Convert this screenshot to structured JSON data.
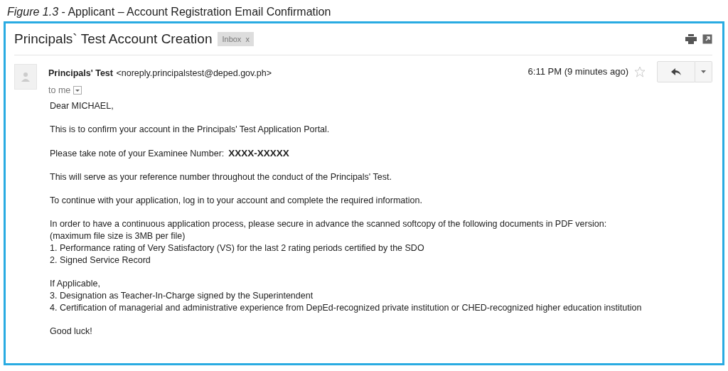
{
  "caption": "*Figure 1.3* - Applicant – Account Registration Email Confirmation",
  "subject": "Principals` Test Account Creation",
  "labels": [
    {
      "text": "Inbox",
      "close": "x"
    }
  ],
  "sender": {
    "name": "Principals' Test",
    "email": "<noreply.principalstest@deped.gov.ph>",
    "recipient": "to me",
    "time": "6:11 PM (9 minutes ago)",
    "starred": false
  },
  "body": [
    {
      "kind": "text",
      "lines": [
        "Dear MICHAEL,"
      ]
    },
    {
      "kind": "text",
      "lines": [
        "This is to confirm your account in the Principals' Test Application Portal."
      ]
    },
    {
      "kind": "number",
      "lines": [
        "Please take note of your Examinee Number:"
      ],
      "value": "XXXX-XXXXX"
    },
    {
      "kind": "text",
      "lines": [
        "This will serve as your reference number throughout the conduct of the Principals' Test."
      ]
    },
    {
      "kind": "text",
      "lines": [
        "To continue with your application, log in to your account and complete the required information."
      ]
    },
    {
      "kind": "text",
      "lines": [
        "In order to have a continuous application process, please secure in advance the scanned softcopy of the following documents in PDF version:",
        "(maximum file size is 3MB per file)",
        "1. Performance rating of Very Satisfactory (VS) for the last 2 rating periods certified by the SDO",
        "2. Signed Service Record"
      ]
    },
    {
      "kind": "text",
      "lines": [
        "If Applicable,",
        "3. Designation as Teacher-In-Charge signed by the Superintendent",
        "4. Certification of managerial and administrative experience from DepEd-recognized private institution or CHED-recognized higher education institution"
      ]
    },
    {
      "kind": "text",
      "lines": [
        "Good luck!"
      ]
    }
  ]
}
